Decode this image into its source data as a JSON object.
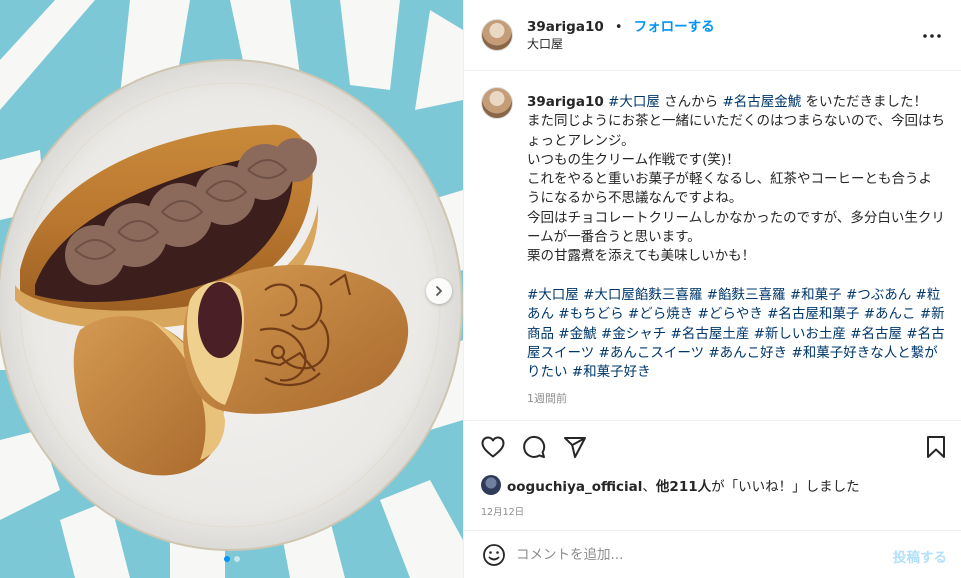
{
  "header": {
    "username": "39ariga10",
    "separator": "•",
    "follow_label": "フォローする",
    "location": "大口屋"
  },
  "caption": {
    "username": "39ariga10",
    "line1": [
      {
        "t": "#大口屋",
        "tag": true
      },
      {
        "t": " さんから ",
        "tag": false
      },
      {
        "t": "#名古屋金鯱",
        "tag": true
      },
      {
        "t": " をいただきました！",
        "tag": false
      }
    ],
    "paragraph": [
      "また同じようにお茶と一緒にいただくのはつまらないので、今回はちょっとアレンジ。",
      "いつもの生クリーム作戦です(笑)！",
      "これをやると重いお菓子が軽くなるし、紅茶やコーヒーとも合うようになるから不思議なんですよね。",
      "今回はチョコレートクリームしかなかったのですが、多分白い生クリームが一番合うと思います。",
      "栗の甘露煮を添えても美味しいかも！"
    ],
    "hashtags": [
      "#大口屋",
      "#大口屋餡麩三喜羅",
      "#餡麩三喜羅",
      "#和菓子",
      "#つぶあん",
      "#粒あん",
      "#もちどら",
      "#どら焼き",
      "#どらやき",
      "#名古屋和菓子",
      "#あんこ",
      "#新商品",
      "#金鯱",
      "#金シャチ",
      "#名古屋土産",
      "#新しいお土産",
      "#名古屋",
      "#名古屋スイーツ",
      "#あんこスイーツ",
      "#あんこ好き",
      "#和菓子好きな人と繋がりたい",
      "#和菓子好き"
    ],
    "age": "1週間前"
  },
  "actions": {
    "like_icon": "heart-icon",
    "comment_icon": "comment-icon",
    "share_icon": "share-icon",
    "save_icon": "bookmark-icon"
  },
  "likes": {
    "user": "ooguchiya_official",
    "middle": "、",
    "count": "他211人",
    "suffix": "が「いいね！」しました"
  },
  "date": "12月12日",
  "comment": {
    "placeholder": "コメントを追加...",
    "post_label": "投稿する"
  },
  "carousel": {
    "slides": 2,
    "current": 1
  },
  "colors": {
    "accent": "#0095f6",
    "hashtag": "#00376b",
    "muted": "#8e8e8e",
    "post_disabled": "#b2dffc"
  }
}
